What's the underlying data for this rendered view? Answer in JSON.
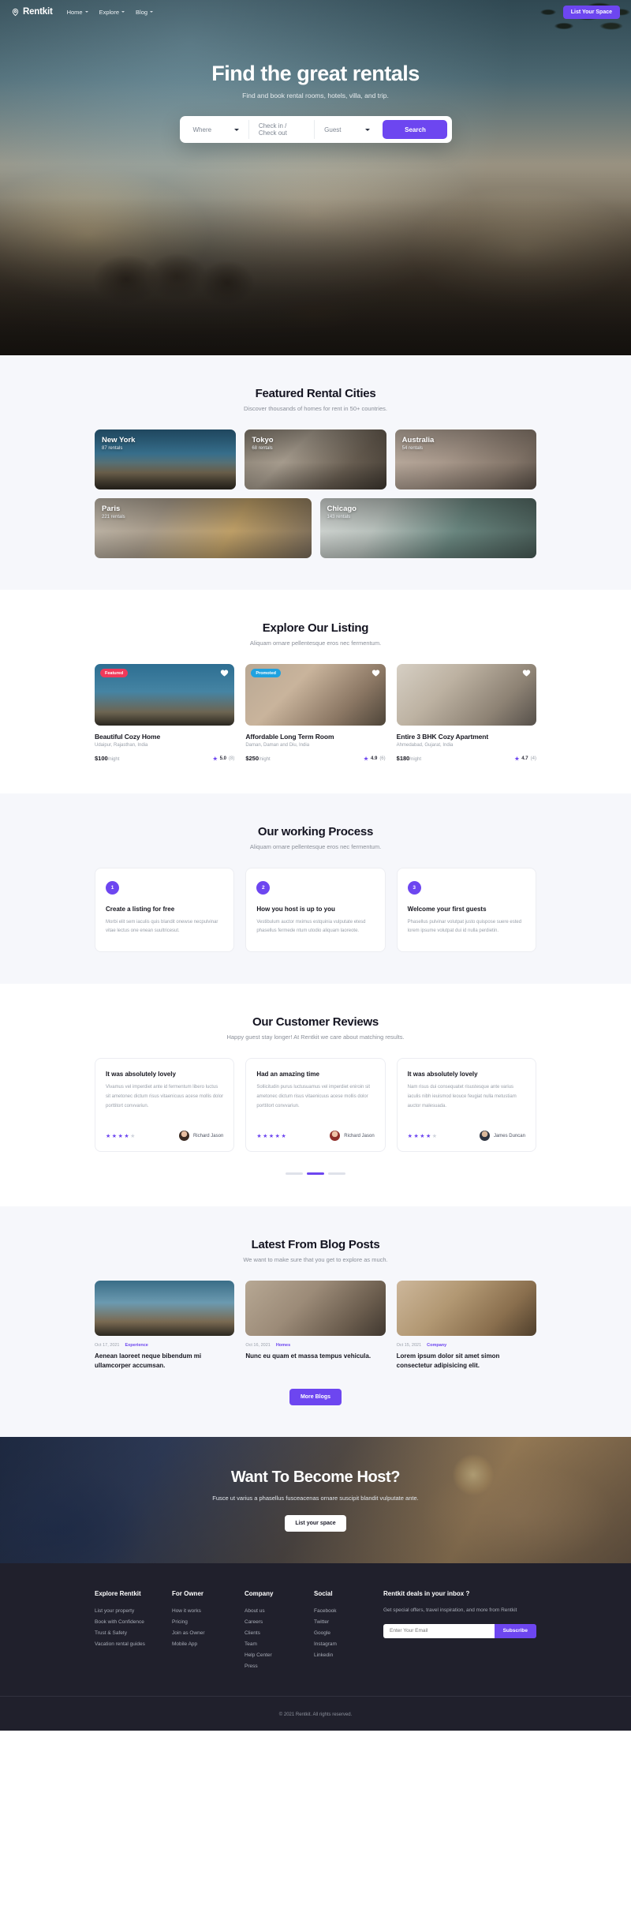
{
  "nav": {
    "brand": "Rentkit",
    "brand_icon": "location-pin-icon",
    "links": [
      {
        "label": "Home",
        "icon": "chevron-down-icon"
      },
      {
        "label": "Explore",
        "icon": "chevron-down-icon"
      },
      {
        "label": "Blog",
        "icon": "chevron-down-icon"
      }
    ],
    "cta": "List Your Space"
  },
  "hero": {
    "title": "Find the great rentals",
    "subtitle": "Find and book rental rooms, hotels, villa, and trip.",
    "search": {
      "where_label": "Where",
      "dates_label": "Check in / Check out",
      "guest_label": "Guest",
      "button": "Search"
    }
  },
  "cities": {
    "title": "Featured Rental Cities",
    "subtitle": "Discover thousands of homes for rent in 50+ countries.",
    "row1": [
      {
        "name": "New York",
        "count": "87 rentals",
        "img": "ph-ny"
      },
      {
        "name": "Tokyo",
        "count": "68 rentals",
        "img": "ph-tokyo"
      },
      {
        "name": "Australia",
        "count": "54 rentals",
        "img": "ph-aus"
      }
    ],
    "row2": [
      {
        "name": "Paris",
        "count": "221 rentals",
        "img": "ph-paris"
      },
      {
        "name": "Chicago",
        "count": "143 rentals",
        "img": "ph-chi"
      }
    ]
  },
  "listings": {
    "title": "Explore Our Listing",
    "subtitle": "Aliquam ornare pellentesque eros nec fermentum.",
    "items": [
      {
        "badge": "Featured",
        "badge_kind": "featured",
        "title": "Beautiful Cozy Home",
        "location": "Udaipur, Rajasthan, India",
        "price": "$100",
        "per": "/night",
        "rating": "5.0",
        "reviews": "(8)",
        "img": "lm-1"
      },
      {
        "badge": "Promoted",
        "badge_kind": "promoted",
        "title": "Affordable Long Term Room",
        "location": "Daman, Daman and Diu, India",
        "price": "$250",
        "per": "/night",
        "rating": "4.9",
        "reviews": "(6)",
        "img": "lm-2"
      },
      {
        "badge": "",
        "badge_kind": "none",
        "title": "Entire 3 BHK Cozy Apartment",
        "location": "Ahmedabad, Gujarat, India",
        "price": "$180",
        "per": "/night",
        "rating": "4.7",
        "reviews": "(4)",
        "img": "lm-3"
      }
    ]
  },
  "process": {
    "title": "Our working Process",
    "subtitle": "Aliquam ornare pellentesque eros nec fermentum.",
    "steps": [
      {
        "num": "1",
        "title": "Create a listing for free",
        "text": "Morbi elit sem iaculis quis blandit onewse necpulvinar vitae lectus one enean suultricesut."
      },
      {
        "num": "2",
        "title": "How you host is up to you",
        "text": "Vestibulum auctor mximus estquinia vulputate etesd phasellus fermede ntum utodio aliquam laoreote."
      },
      {
        "num": "3",
        "title": "Welcome your first guests",
        "text": "Phasellus pulvinar volutpat justo quispose suere ested lorem ipsume volutpat dui id nulla perdietin."
      }
    ]
  },
  "reviews": {
    "title": "Our Customer Reviews",
    "subtitle": "Happy guest stay longer! At Rentkit we care about matching results.",
    "items": [
      {
        "title": "It was absolutely lovely",
        "text": "Vivamus vel imperdiet ante id fermentum libero luctus sit ametonec dictum risus vitaenicuus acese mollis dolor porttitort convvariun.",
        "stars": 4,
        "name": "Richard Jason",
        "avatar": "av1"
      },
      {
        "title": "Had an amazing time",
        "text": "Sollicitudin purus luctusuamus vel imperdiet eniroin sit ametonec dictum risus vitaenicuus acese mollis dolor porttitort convvariun.",
        "stars": 5,
        "name": "Richard Jason",
        "avatar": "av2"
      },
      {
        "title": "It was absolutely lovely",
        "text": "Nam risus dui consequatet risustesque ante varius iaculis nibh ieuismod leouce feugiat nulla metustiam auctor malesuada.",
        "stars": 4,
        "name": "James Duncan",
        "avatar": "av3"
      }
    ],
    "active_dot": 1,
    "dot_count": 3
  },
  "blog": {
    "title": "Latest From Blog Posts",
    "subtitle": "We want to make sure that you get to explore as much.",
    "items": [
      {
        "date": "Oct 17, 2021",
        "category": "Experience",
        "title": "Aenean laoreet neque bibendum mi ullamcorper accumsan.",
        "img": "bm-1"
      },
      {
        "date": "Oct 16, 2021",
        "category": "Homes",
        "title": "Nunc eu quam et massa tempus vehicula.",
        "img": "bm-2"
      },
      {
        "date": "Oct 15, 2021",
        "category": "Company",
        "title": "Lorem ipsum dolor sit amet simon consectetur adipisicing elit.",
        "img": "bm-3"
      }
    ],
    "more_button": "More Blogs"
  },
  "host": {
    "title": "Want To Become Host?",
    "subtitle": "Fusce ut varius a phasellus fusceacenas ornare suscipit blandit vulputate ante.",
    "button": "List your space"
  },
  "footer": {
    "columns": [
      {
        "heading": "Explore Rentkit",
        "links": [
          "List your property",
          "Book with Confidence",
          "Trust & Safety",
          "Vacation rental guides"
        ]
      },
      {
        "heading": "For Owner",
        "links": [
          "How it works",
          "Pricing",
          "Join as Owner",
          "Mobile App"
        ]
      },
      {
        "heading": "Company",
        "links": [
          "About us",
          "Careers",
          "Clients",
          "Team",
          "Help Center",
          "Press"
        ]
      },
      {
        "heading": "Social",
        "links": [
          "Facebook",
          "Twitter",
          "Google",
          "Instagram",
          "Linkedin"
        ]
      }
    ],
    "newsletter": {
      "heading": "Rentkit deals in your inbox ?",
      "description": "Get special offers, travel inspiration, and more from Rentkit",
      "placeholder": "Enter Your Email",
      "value": "",
      "button": "Subscribe"
    },
    "copyright": "© 2021 Rentkit. All rights reserved."
  },
  "colors": {
    "accent": "#6d46f0",
    "featured_badge": "#f0395a",
    "promoted_badge": "#1fa2e0",
    "footer_bg": "#20202c",
    "section_grey": "#f6f7fb"
  }
}
